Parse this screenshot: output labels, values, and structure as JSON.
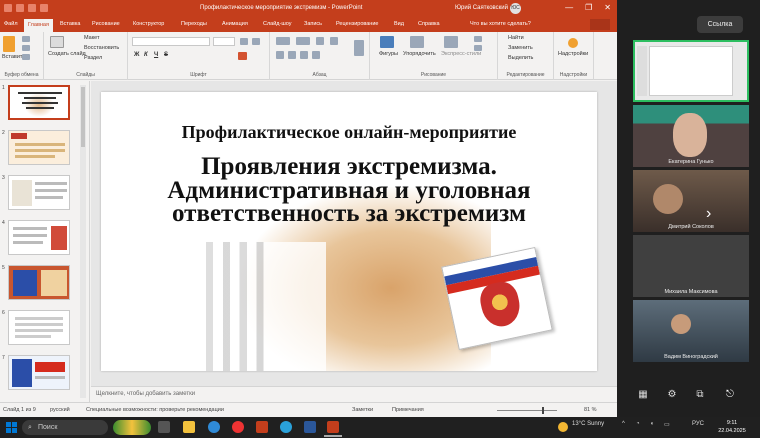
{
  "window": {
    "title": "Профилактическое мероприятие экстремизм  -  PowerPoint",
    "user": "Юрий Саятковский",
    "user_initials": "ЮС",
    "controls": [
      "—",
      "❐",
      "✕"
    ]
  },
  "ribbon_tabs": [
    {
      "label": "Файл"
    },
    {
      "label": "Главная",
      "active": true
    },
    {
      "label": "Вставка"
    },
    {
      "label": "Рисование"
    },
    {
      "label": "Конструктор"
    },
    {
      "label": "Переходы"
    },
    {
      "label": "Анимация"
    },
    {
      "label": "Слайд-шоу"
    },
    {
      "label": "Запись"
    },
    {
      "label": "Рецензирование"
    },
    {
      "label": "Вид"
    },
    {
      "label": "Справка"
    }
  ],
  "tell_me": "Что вы хотите сделать?",
  "ribbon": {
    "clipboard": {
      "paste": "Вставить",
      "group": "Буфер обмена"
    },
    "slides": {
      "new_slide": "Создать слайд",
      "layout": "Макет",
      "reset": "Восстановить",
      "section": "Раздел",
      "group": "Слайды"
    },
    "font": {
      "bold": "Ж",
      "italic": "К",
      "underline": "Ч",
      "strike": "S",
      "group": "Шрифт"
    },
    "paragraph": {
      "group": "Абзац"
    },
    "drawing": {
      "shapes": "Фигуры",
      "arrange": "Упорядочить",
      "styles": "Экспресс-стили",
      "group": "Рисование"
    },
    "editing": {
      "find": "Найти",
      "replace": "Заменить",
      "select": "Выделить",
      "group": "Редактирование"
    },
    "addins": {
      "label": "Надстройки",
      "group": "Надстройки"
    }
  },
  "thumbnails": [
    {
      "num": "1",
      "selected": true
    },
    {
      "num": "2"
    },
    {
      "num": "3"
    },
    {
      "num": "4"
    },
    {
      "num": "5"
    },
    {
      "num": "6"
    },
    {
      "num": "7"
    }
  ],
  "slide": {
    "subtitle": "Профилактическое онлайн-мероприятие",
    "title": "Проявления экстремизма. Административная и уголовная ответственность за экстремизм"
  },
  "notes_placeholder": "Щелкните, чтобы добавить заметки",
  "status": {
    "slide_count": "Слайд 1 из 9",
    "language": "русский",
    "accessibility": "Специальные возможности: проверьте рекомендации",
    "notes": "Заметки",
    "comments": "Примечания",
    "zoom": "81 %"
  },
  "meeting": {
    "link_button": "Ссылка",
    "participants": [
      {
        "name": "Екатерина Гунько"
      },
      {
        "name": "Дмитрий Соколов"
      },
      {
        "name": "Михаила Максимова"
      },
      {
        "name": "Вадим Виноградский"
      }
    ]
  },
  "taskbar": {
    "search": "Поиск",
    "weather": "13°C  Sunny",
    "lang": "РУС",
    "time": "9:11",
    "date": "22.04.2025"
  },
  "colors": {
    "ppt_accent": "#c43e1c",
    "active_speaker": "#2dbe60",
    "taskbar": "#202020"
  }
}
